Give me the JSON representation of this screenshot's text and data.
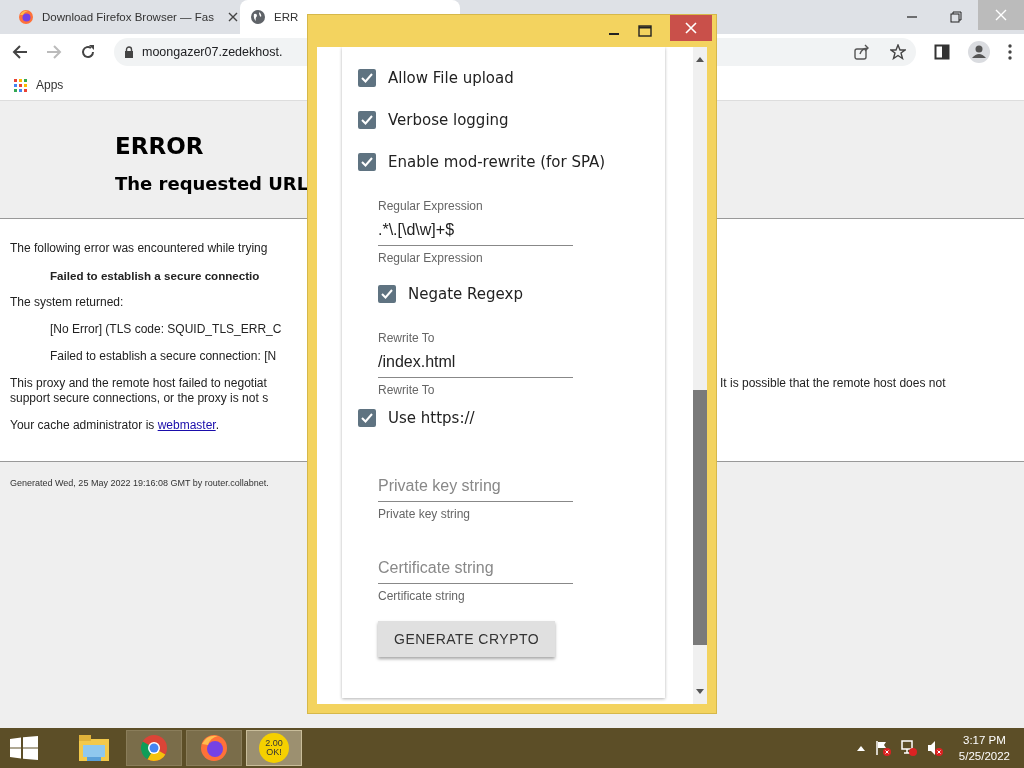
{
  "browser": {
    "tabs": [
      {
        "title": "Download Firefox Browser — Fas",
        "kind": "firefox",
        "selected": false
      },
      {
        "title": "ERR",
        "kind": "globe",
        "selected": true
      }
    ],
    "address": "moongazer07.zedekhost.",
    "bookmarks": [
      {
        "label": "Apps"
      }
    ]
  },
  "page": {
    "heading": "ERROR",
    "subheading": "The requested URL",
    "paragraphs": [
      {
        "kind": "text",
        "text": "The following error was encountered while trying"
      },
      {
        "kind": "bold-indent",
        "text": "Failed to establish a secure connectio"
      },
      {
        "kind": "text",
        "text": "The system returned:"
      },
      {
        "kind": "indent",
        "text": "[No Error] (TLS code: SQUID_TLS_ERR_C"
      },
      {
        "kind": "indent",
        "text": "Failed to establish a secure connection: [N"
      },
      {
        "kind": "text",
        "text": "This proxy and the remote host failed to negotiat\nsupport secure connections, or the proxy is not s",
        "right": "It is possible that the remote host does not"
      },
      {
        "kind": "link",
        "text": "Your cache administrator is ",
        "link": "webmaster",
        "after": "."
      }
    ],
    "footer": "Generated Wed, 25 May 2022 19:16:08 GMT by router.collabnet."
  },
  "dialog": {
    "items": [
      {
        "kind": "checkbox",
        "label": "Allow File upload",
        "checked": true,
        "nested": false
      },
      {
        "kind": "checkbox",
        "label": "Verbose logging",
        "checked": true,
        "nested": false
      },
      {
        "kind": "checkbox",
        "label": "Enable mod-rewrite (for SPA)",
        "checked": true,
        "nested": false
      },
      {
        "kind": "field",
        "label": "Regular Expression",
        "value": ".*\\.[\\d\\w]+$",
        "helper": "Regular Expression"
      },
      {
        "kind": "checkbox",
        "label": "Negate Regexp",
        "checked": true,
        "nested": true
      },
      {
        "kind": "field",
        "label": "Rewrite To",
        "value": "/index.html",
        "helper": "Rewrite To"
      },
      {
        "kind": "checkbox",
        "label": "Use https://",
        "checked": true,
        "nested": false
      },
      {
        "kind": "field",
        "placeholder": "Private key string",
        "helper": "Private key string"
      },
      {
        "kind": "field",
        "placeholder": "Certificate string",
        "helper": "Certificate string"
      },
      {
        "kind": "button",
        "label": "GENERATE CRYPTO"
      }
    ]
  },
  "taskbar": {
    "apps": [
      {
        "kind": "explorer",
        "selected": false
      },
      {
        "kind": "chrome",
        "selected": false
      },
      {
        "kind": "firefox",
        "selected": false
      },
      {
        "kind": "yellow",
        "label": "2.00 OK!",
        "selected": true
      }
    ],
    "time": "3:17 PM",
    "date": "5/25/2022"
  }
}
